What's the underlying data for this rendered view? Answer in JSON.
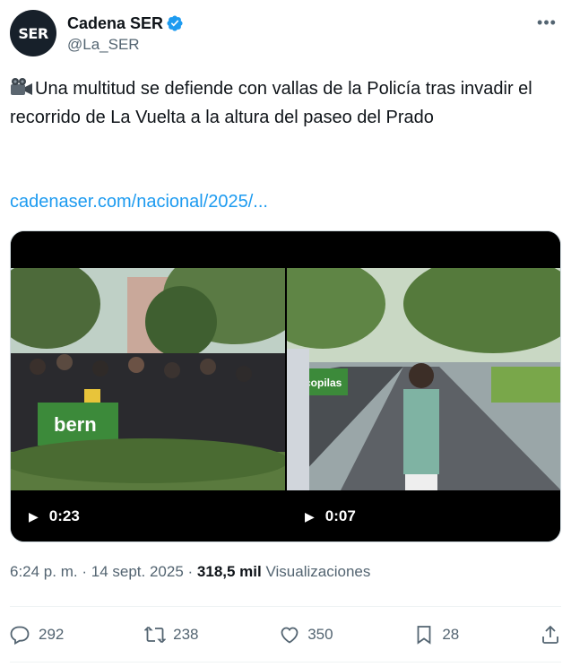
{
  "author": {
    "avatar_text": "SER",
    "display_name": "Cadena SER",
    "handle": "@La_SER"
  },
  "tweet": {
    "text": "Una multitud se defiende con vallas de la Policía tras invadir el recorrido de La Vuelta a la altura del paseo del Prado",
    "link": "cadenaser.com/nacional/2025/..."
  },
  "media": {
    "videos": [
      {
        "duration": "0:23",
        "banner_text": "bern"
      },
      {
        "duration": "0:07",
        "banner_text": "copilas"
      }
    ]
  },
  "meta": {
    "time": "6:24 p. m.",
    "separator": "·",
    "date": "14 sept. 2025",
    "views_count": "318,5 mil",
    "views_label": "Visualizaciones"
  },
  "actions": {
    "replies": "292",
    "reposts": "238",
    "likes": "350",
    "bookmarks": "28"
  },
  "colors": {
    "link": "#1d9bf0",
    "secondary_text": "#536471",
    "verified": "#1d9bf0"
  }
}
